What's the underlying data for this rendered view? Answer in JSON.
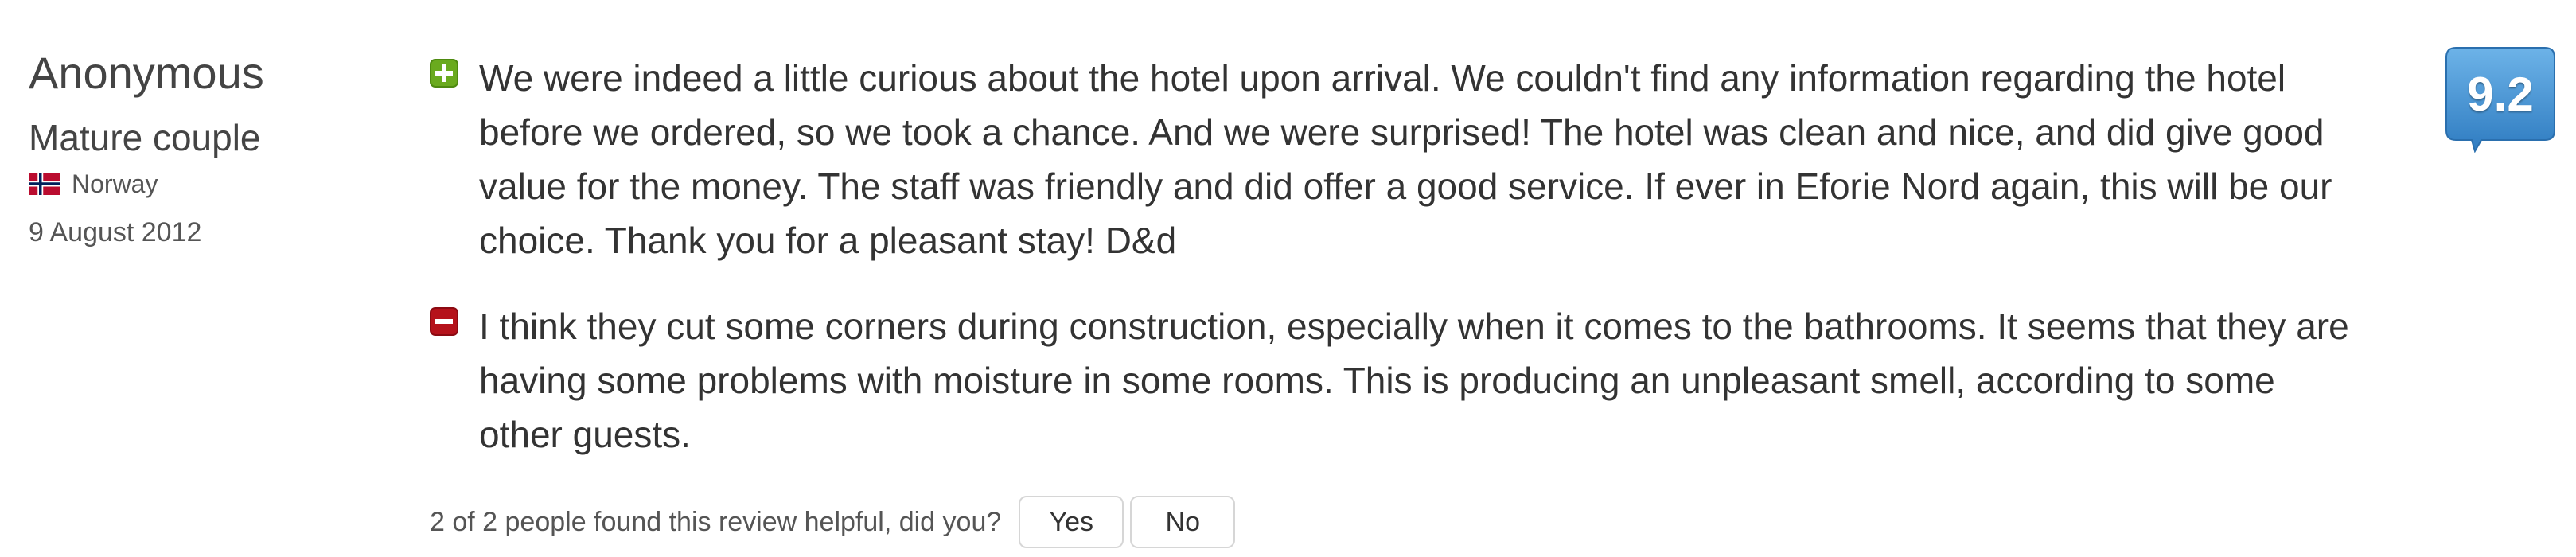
{
  "reviewer": {
    "name": "Anonymous",
    "type": "Mature couple",
    "country": "Norway",
    "date": "9 August 2012"
  },
  "review": {
    "positive": "We were indeed a little curious about the hotel upon arrival. We couldn't find any information regarding the hotel before we ordered, so we took a chance. And we were surprised! The hotel was clean and nice, and did give good value for the money. The staff was friendly and did offer a good service. If ever in Eforie Nord again, this will be our choice. Thank you for a pleasant stay! D&d",
    "negative": "I think they cut some corners during construction, especially when it comes to the bathrooms. It seems that they are having some problems with moisture in some rooms. This is producing an unpleasant smell, according to some other guests."
  },
  "helpful": {
    "text": "2 of 2 people found this review helpful, did you?",
    "yes_label": "Yes",
    "no_label": "No"
  },
  "score": "9.2",
  "colors": {
    "positive_marker": "#6aaa1e",
    "negative_marker": "#b5121b",
    "score_badge": "#3f8fd0"
  },
  "icons": {
    "positive": "plus-icon",
    "negative": "minus-icon",
    "flag": "norway-flag-icon"
  }
}
